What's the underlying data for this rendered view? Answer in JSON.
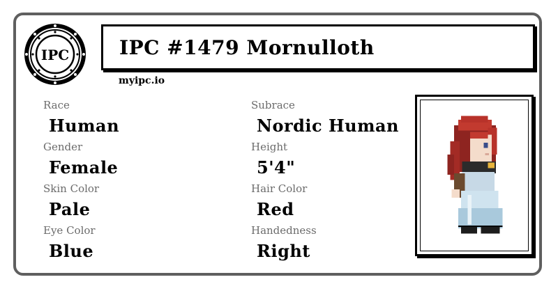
{
  "card": {
    "logo_text": "IPC",
    "title": "IPC #1479 Mornulloth",
    "site": "myipc.io"
  },
  "fields": {
    "race": {
      "label": "Race",
      "value": "Human"
    },
    "subrace": {
      "label": "Subrace",
      "value": "Nordic Human"
    },
    "gender": {
      "label": "Gender",
      "value": "Female"
    },
    "height": {
      "label": "Height",
      "value": "5'4\""
    },
    "skin_color": {
      "label": "Skin Color",
      "value": "Pale"
    },
    "hair_color": {
      "label": "Hair Color",
      "value": "Red"
    },
    "eye_color": {
      "label": "Eye Color",
      "value": "Blue"
    },
    "handedness": {
      "label": "Handedness",
      "value": "Right"
    }
  },
  "colors": {
    "border": "#5f5f5f",
    "label": "#6b6b6b",
    "hair": "#b8322a",
    "dress": "#cfe3ef"
  }
}
